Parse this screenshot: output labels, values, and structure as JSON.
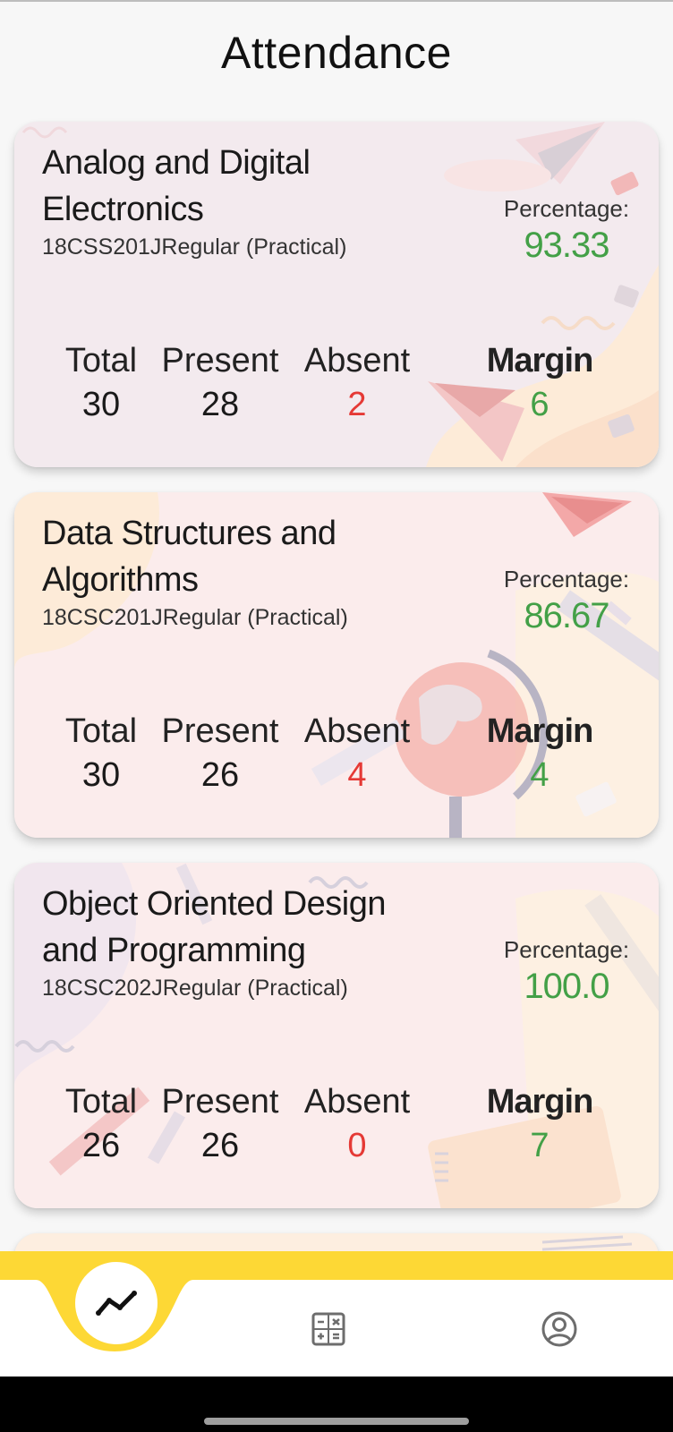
{
  "page": {
    "title": "Attendance"
  },
  "courses": [
    {
      "name": "Analog and Digital Electronics",
      "code": "18CSS201JRegular (Practical)",
      "percentage_label": "Percentage:",
      "percentage": "93.33",
      "total_label": "Total",
      "total": "30",
      "present_label": "Present",
      "present": "28",
      "absent_label": "Absent",
      "absent": "2",
      "margin_label": "Margin",
      "margin": "6"
    },
    {
      "name": "Data Structures and Algorithms",
      "code": "18CSC201JRegular (Practical)",
      "percentage_label": "Percentage:",
      "percentage": "86.67",
      "total_label": "Total",
      "total": "30",
      "present_label": "Present",
      "present": "26",
      "absent_label": "Absent",
      "absent": "4",
      "margin_label": "Margin",
      "margin": "4"
    },
    {
      "name": "Object Oriented Design and Programming",
      "code": "18CSC202JRegular (Practical)",
      "percentage_label": "Percentage:",
      "percentage": "100.0",
      "total_label": "Total",
      "total": "26",
      "present_label": "Present",
      "present": "26",
      "absent_label": "Absent",
      "absent": "0",
      "margin_label": "Margin",
      "margin": "7"
    }
  ],
  "nav": {
    "items": [
      {
        "icon": "trending-chart-icon",
        "active": true
      },
      {
        "icon": "calculator-icon",
        "active": false
      },
      {
        "icon": "profile-icon",
        "active": false
      }
    ]
  },
  "colors": {
    "accent": "#fdd835",
    "present_green": "#43a047",
    "absent_red": "#e53935"
  }
}
